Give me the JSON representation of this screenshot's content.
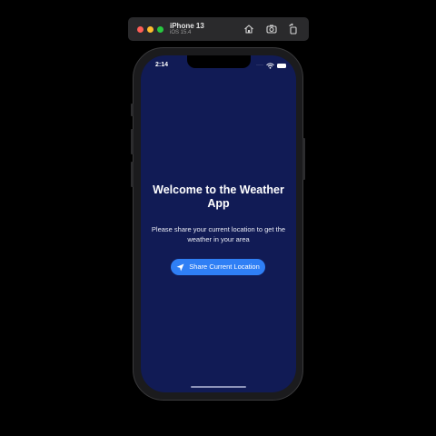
{
  "simulator": {
    "device_name": "iPhone 13",
    "os_version": "iOS 15.4",
    "icons": [
      "home-icon",
      "screenshot-icon",
      "rotate-icon"
    ]
  },
  "status_bar": {
    "time": "2:14",
    "signal": "····",
    "icons": [
      "wifi-icon",
      "battery-icon"
    ]
  },
  "app": {
    "welcome_title": "Welcome to the Weather App",
    "prompt_text": "Please share your current location to get the weather in your area",
    "share_button_label": "Share Current Location",
    "share_button_icon": "location-arrow-icon"
  },
  "colors": {
    "screen_background": "#111b55",
    "button_background": "#2f7ff5",
    "text": "#ffffff"
  }
}
